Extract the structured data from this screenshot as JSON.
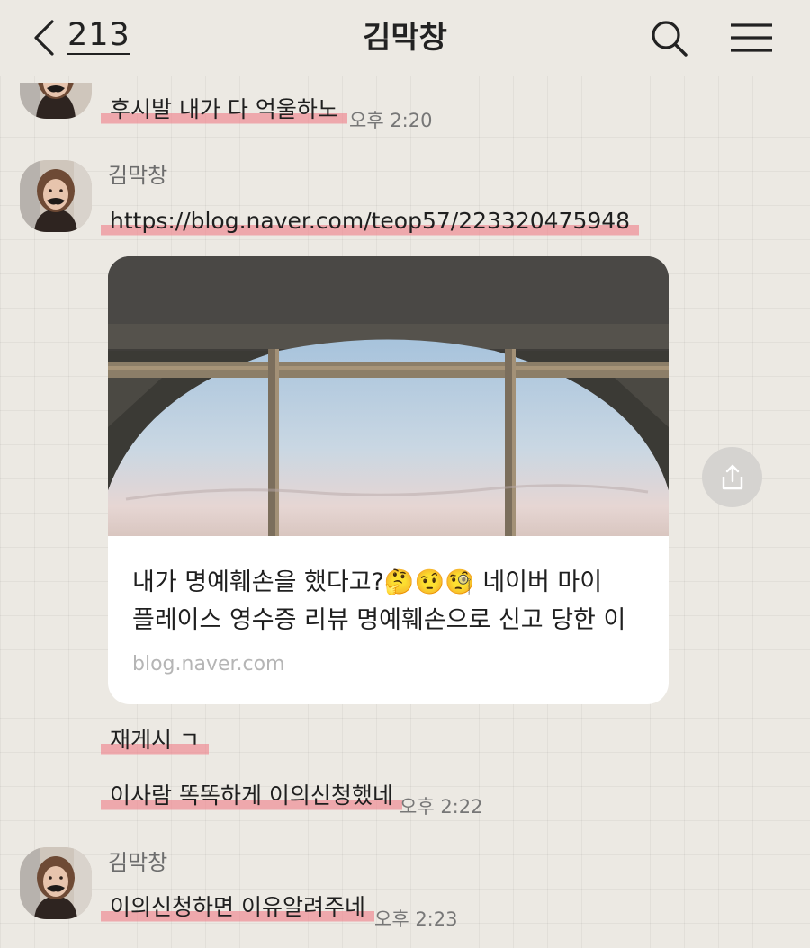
{
  "header": {
    "back_count": "213",
    "title": "김막창"
  },
  "messages": [
    {
      "text": "후시발 내가 다 억울하노",
      "time": "오후 2:20"
    },
    {
      "sender": "김막창",
      "text": "https://blog.naver.com/teop57/223320475948"
    },
    {
      "text": "재게시 ㄱ"
    },
    {
      "text": "이사람 똑똑하게 이의신청했네",
      "time": "오후 2:22"
    },
    {
      "sender": "김막창",
      "text": "이의신청하면 이유알려주네",
      "time": "오후 2:23"
    }
  ],
  "link_preview": {
    "title_line1": "내가 명예훼손을 했다고?🤔🤨🧐 네이버 마이",
    "title_line2": "플레이스 영수증 리뷰 명예훼손으로 신고 당한 이",
    "domain": "blog.naver.com"
  },
  "icons": {
    "back": "chevron-left-icon",
    "search": "search-icon",
    "menu": "hamburger-menu-icon",
    "share": "share-icon"
  },
  "colors": {
    "highlight": "#f0808a",
    "background": "#ece9e3",
    "card": "#ffffff"
  }
}
